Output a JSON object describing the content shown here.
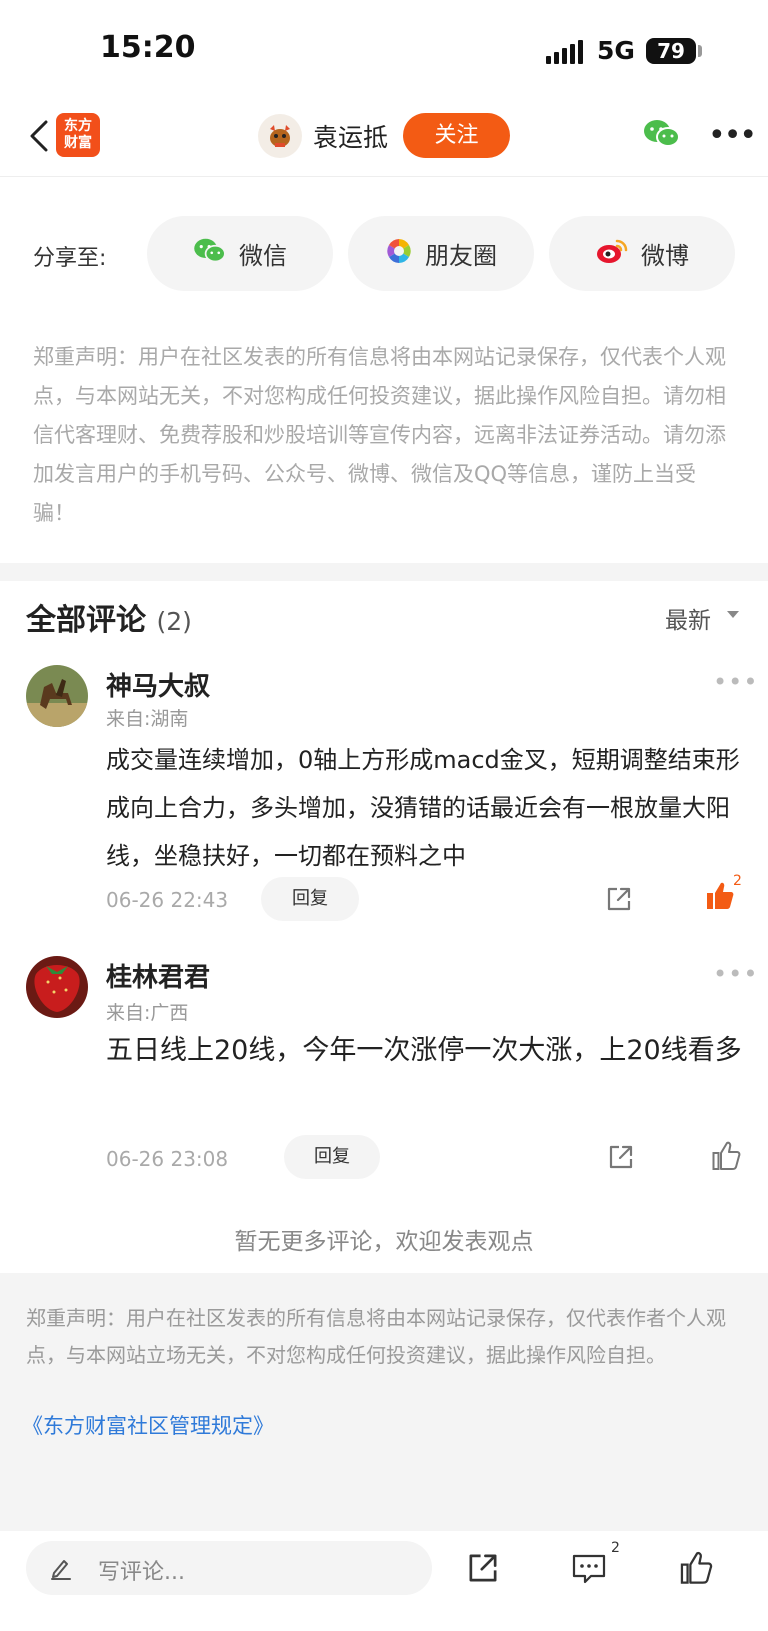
{
  "status_bar": {
    "time": "15:20",
    "network": "5G",
    "battery": "79"
  },
  "nav": {
    "logo_text": "东方财富",
    "author_name": "袁运抵",
    "follow_label": "关注"
  },
  "share": {
    "label": "分享至:",
    "buttons": [
      {
        "label": "微信",
        "icon": "wechat-icon"
      },
      {
        "label": "朋友圈",
        "icon": "moments-icon"
      },
      {
        "label": "微博",
        "icon": "weibo-icon"
      }
    ]
  },
  "disclaimer": "郑重声明：用户在社区发表的所有信息将由本网站记录保存，仅代表个人观点，与本网站无关，不对您构成任何投资建议，据此操作风险自担。请勿相信代客理财、免费荐股和炒股培训等宣传内容，远离非法证券活动。请勿添加发言用户的手机号码、公众号、微博、微信及QQ等信息，谨防上当受骗！",
  "comments_header": {
    "title": "全部评论",
    "count": "(2)",
    "sort_label": "最新"
  },
  "comments": [
    {
      "name": "神马大叔",
      "location": "来自:湖南",
      "text": "成交量连续增加，0轴上方形成macd金叉，短期调整结束形成向上合力，多头增加，没猜错的话最近会有一根放量大阳线，坐稳扶好，一切都在预料之中",
      "time": "06-26 22:43",
      "reply_label": "回复",
      "like_count": "2",
      "avatar_text": "神马大叔"
    },
    {
      "name": "桂林君君",
      "location": "来自:广西",
      "text": "五日线上20线，今年一次涨停一次大涨，上20线看多",
      "time": "06-26 23:08",
      "reply_label": "回复",
      "like_count": ""
    }
  ],
  "no_more": "暂无更多评论，欢迎发表观点",
  "footer": {
    "disclaimer": "郑重声明：用户在社区发表的所有信息将由本网站记录保存，仅代表作者个人观点，与本网站立场无关，不对您构成任何投资建议，据此操作风险自担。",
    "rules_link": "《东方财富社区管理规定》"
  },
  "bottom_bar": {
    "write_placeholder": "写评论...",
    "comment_count": "2"
  },
  "colors": {
    "brand_orange": "#f35b14",
    "link_blue": "#2f7ad9",
    "muted_gray": "#a9a9a9"
  }
}
